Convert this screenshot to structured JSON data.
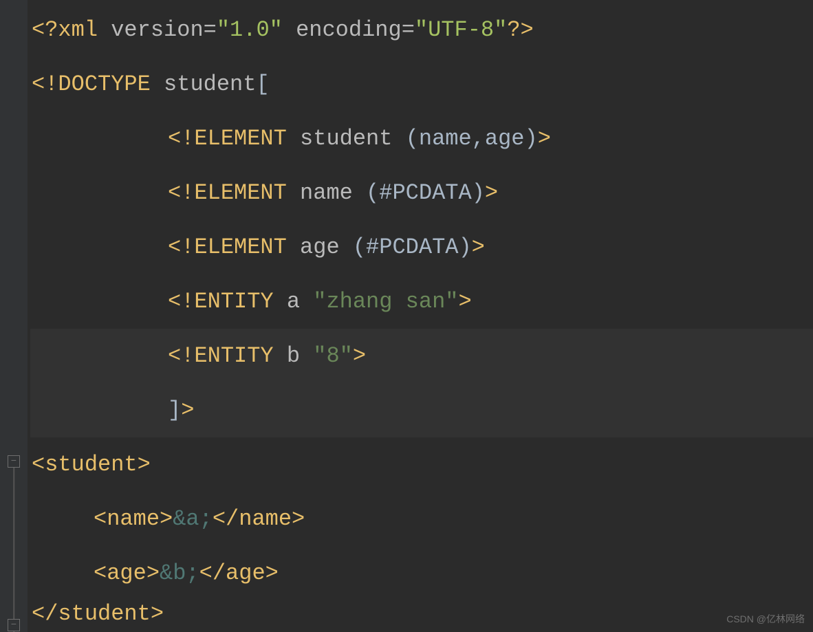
{
  "code": {
    "line1": {
      "open": "<?",
      "tag": "xml",
      "sp1": " ",
      "attr1": "version",
      "eq1": "=",
      "val1": "\"1.0\"",
      "sp2": " ",
      "attr2": "encoding",
      "eq2": "=",
      "val2": "\"UTF-8\"",
      "close": "?>"
    },
    "line2": {
      "open": "<!",
      "kw": "DOCTYPE",
      "sp": " ",
      "name": "student",
      "bracket": "["
    },
    "line3": {
      "open": "<!",
      "kw": "ELEMENT",
      "sp1": " ",
      "name": "student",
      "sp2": " ",
      "content": "(name,age)",
      "close": ">"
    },
    "line4": {
      "open": "<!",
      "kw": "ELEMENT",
      "sp1": " ",
      "name": "name",
      "sp2": " ",
      "content": "(#PCDATA)",
      "close": ">"
    },
    "line5": {
      "open": "<!",
      "kw": "ELEMENT",
      "sp1": " ",
      "name": "age",
      "sp2": " ",
      "content": "(#PCDATA)",
      "close": ">"
    },
    "line6": {
      "open": "<!",
      "kw": "ENTITY",
      "sp1": " ",
      "name": "a",
      "sp2": " ",
      "val": "\"zhang san\"",
      "close": ">"
    },
    "line7": {
      "open": "<!",
      "kw": "ENTITY",
      "sp1": " ",
      "name": "b",
      "sp2": " ",
      "val": "\"8\"",
      "close": ">"
    },
    "line8": {
      "bracket": "]",
      "close": ">"
    },
    "line9": {
      "open": "<",
      "tag": "student",
      "close": ">"
    },
    "line10": {
      "open": "<",
      "tag": "name",
      "close1": ">",
      "entity": "&a;",
      "open2": "</",
      "tag2": "name",
      "close2": ">"
    },
    "line11": {
      "open": "<",
      "tag": "age",
      "close1": ">",
      "entity": "&b;",
      "open2": "</",
      "tag2": "age",
      "close2": ">"
    },
    "line12": {
      "open": "</",
      "tag": "student",
      "close": ">"
    }
  },
  "fold": {
    "minus": "−"
  },
  "watermark": "CSDN @亿林网络"
}
